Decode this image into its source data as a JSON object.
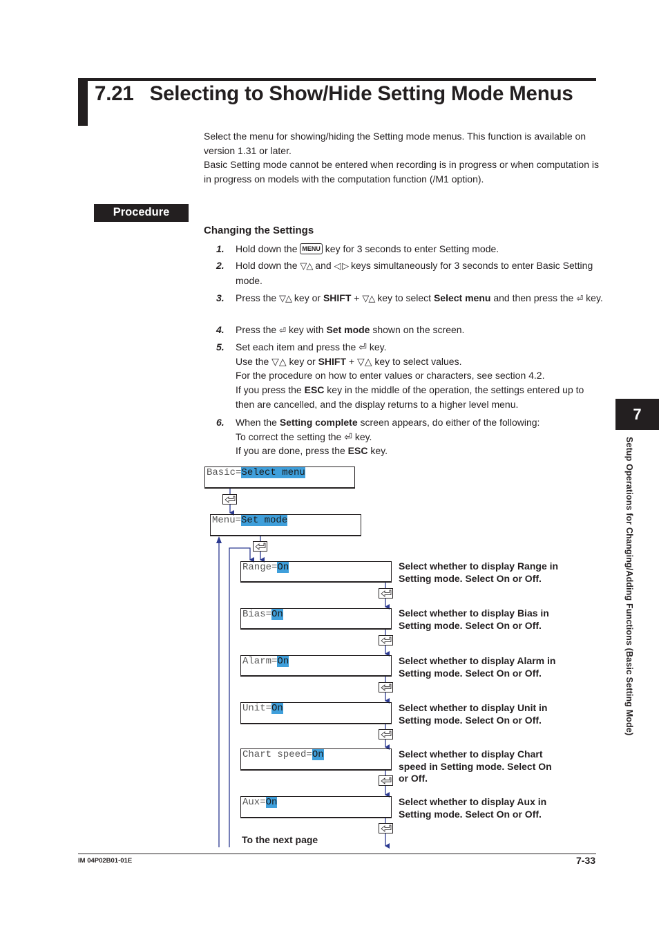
{
  "header": {
    "section_number": "7.21",
    "title": "Selecting to Show/Hide Setting Mode Menus"
  },
  "intro": {
    "line1": "Select the menu for showing/hiding the Setting mode menus. This function is available on version 1.31 or later.",
    "line2": "Basic Setting mode cannot be entered when recording is in progress or when computation is in progress on models with the computation function (/M1 option)."
  },
  "procedure_label": "Procedure",
  "subheading": "Changing the Settings",
  "steps": [
    {
      "num": "1.",
      "parts": [
        "Hold down the ",
        "MENU",
        " key for 3 seconds to enter Setting mode."
      ]
    },
    {
      "num": "2.",
      "parts": [
        "Hold down the ",
        "▽△",
        " and ",
        "◁ ▷",
        " keys simultaneously for 3 seconds to enter Basic Setting mode."
      ]
    },
    {
      "num": "3.",
      "parts": [
        "Press the ",
        "▽△",
        " key or ",
        "SHIFT",
        " + ",
        "▽△",
        " key to select ",
        "Select menu",
        " and then press the ",
        "⏎",
        " key."
      ]
    },
    {
      "num": "4.",
      "parts": [
        "Press the ",
        "⏎",
        " key with ",
        "Set mode",
        " shown on the screen."
      ]
    },
    {
      "num": "5.",
      "lines": [
        "Set each item and press the ⏎ key.",
        "Use the ▽△ key or SHIFT + ▽△ key to select values.",
        "For the procedure on how to enter values or characters, see section 4.2.",
        "If you press the ESC key in the middle of the operation, the settings entered up to then are cancelled, and the display returns to a higher level menu."
      ]
    },
    {
      "num": "6.",
      "lines": [
        "When the Setting complete screen appears, do either of the following:",
        "To correct the setting the ⏎ key.",
        "If you are done, press the ESC key."
      ]
    }
  ],
  "keys": {
    "menu": "MENU",
    "updown": "▽△",
    "leftright": "◁ ▷",
    "enter": "⏎",
    "shift": "SHIFT",
    "esc": "ESC",
    "select_menu": "Select menu",
    "set_mode": "Set mode",
    "setting_complete": "Setting complete"
  },
  "diagram": {
    "screens": [
      {
        "label": "Basic=",
        "value": "Select menu"
      },
      {
        "label": "Menu=",
        "value": "Set mode"
      },
      {
        "label": "Range=",
        "value": "On",
        "desc": "Select whether to display Range in Setting mode. Select On or Off."
      },
      {
        "label": "Bias=",
        "value": "On",
        "desc": "Select whether to display Bias in Setting mode. Select On or Off."
      },
      {
        "label": "Alarm=",
        "value": "On",
        "desc": "Select whether to display Alarm in Setting mode. Select On or Off."
      },
      {
        "label": "Unit=",
        "value": "On",
        "desc": "Select whether to display Unit in Setting mode. Select On or Off."
      },
      {
        "label": "Chart speed=",
        "value": "On",
        "desc": "Select whether to display Chart speed in Setting mode. Select On or Off."
      },
      {
        "label": "Aux=",
        "value": "On",
        "desc": "Select whether to display Aux in Setting mode. Select On or Off."
      }
    ],
    "next_page": "To the next page",
    "highlight_color": "#3f9fdb",
    "arrow_color": "#2b3990"
  },
  "side_tab": {
    "chapter": "7",
    "title": "Setup Operations for Changing/Adding Functions (Basic Setting Mode)"
  },
  "footer": {
    "doc_id": "IM 04P02B01-01E",
    "page": "7-33"
  }
}
